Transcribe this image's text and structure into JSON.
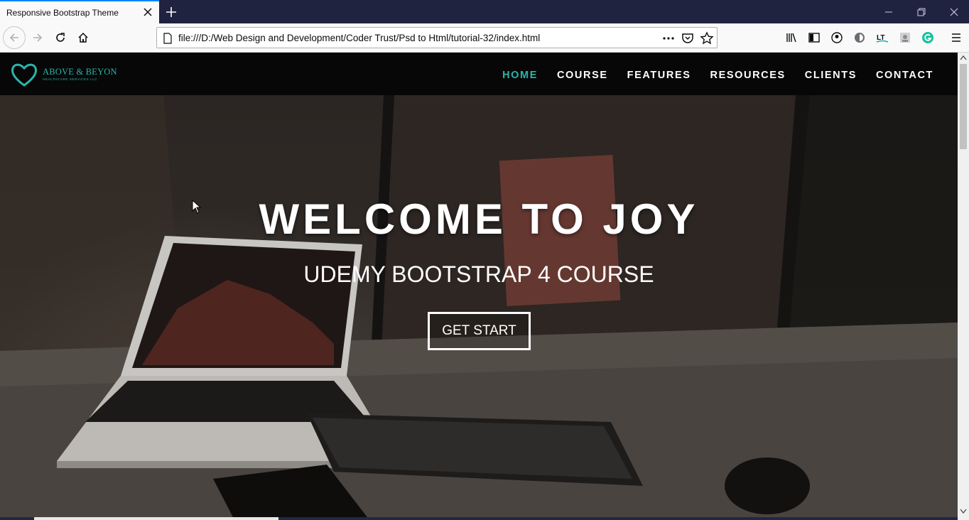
{
  "browser": {
    "tab_title": "Responsive Bootstrap Theme",
    "url": "file:///D:/Web Design and Development/Coder Trust/Psd to Html/tutorial-32/index.html"
  },
  "site": {
    "logo_text": "ABOVE & BEYON",
    "logo_subtext": "HEALTHCARE SERVICES LLC",
    "menu": [
      {
        "label": "HOME",
        "active": true
      },
      {
        "label": "COURSE",
        "active": false
      },
      {
        "label": "FEATURES",
        "active": false
      },
      {
        "label": "RESOURCES",
        "active": false
      },
      {
        "label": "CLIENTS",
        "active": false
      },
      {
        "label": "CONTACT",
        "active": false
      }
    ],
    "hero": {
      "title": "WELCOME TO JOY",
      "subtitle": "UDEMY BOOTSTRAP 4 COURSE",
      "button_label": "GET START"
    }
  },
  "colors": {
    "accent": "#2bb5ad",
    "nav_bg": "#070707",
    "browser_titlebar": "#202340"
  }
}
